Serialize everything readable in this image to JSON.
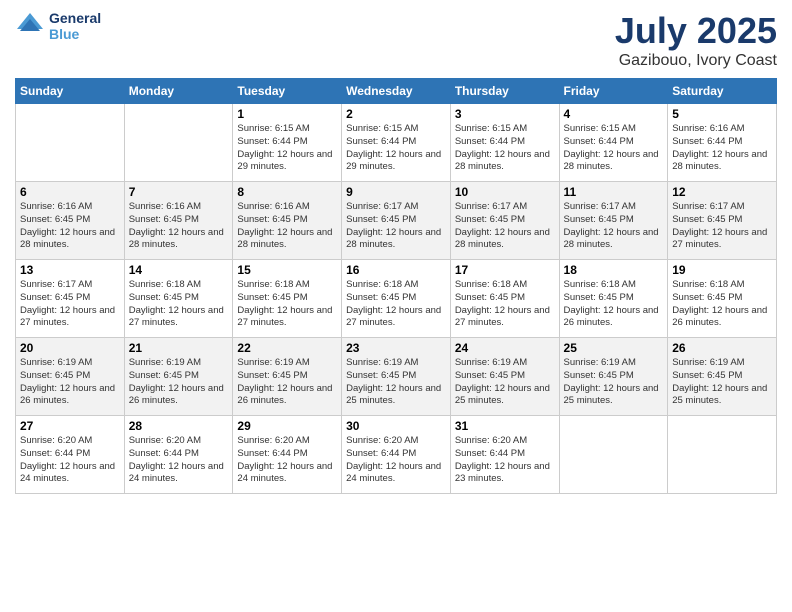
{
  "app": {
    "logo_line1": "General",
    "logo_line2": "Blue"
  },
  "header": {
    "title": "July 2025",
    "location": "Gazibouo, Ivory Coast"
  },
  "weekdays": [
    "Sunday",
    "Monday",
    "Tuesday",
    "Wednesday",
    "Thursday",
    "Friday",
    "Saturday"
  ],
  "weeks": [
    [
      {
        "day": "",
        "sunrise": "",
        "sunset": "",
        "daylight": ""
      },
      {
        "day": "",
        "sunrise": "",
        "sunset": "",
        "daylight": ""
      },
      {
        "day": "1",
        "sunrise": "Sunrise: 6:15 AM",
        "sunset": "Sunset: 6:44 PM",
        "daylight": "Daylight: 12 hours and 29 minutes."
      },
      {
        "day": "2",
        "sunrise": "Sunrise: 6:15 AM",
        "sunset": "Sunset: 6:44 PM",
        "daylight": "Daylight: 12 hours and 29 minutes."
      },
      {
        "day": "3",
        "sunrise": "Sunrise: 6:15 AM",
        "sunset": "Sunset: 6:44 PM",
        "daylight": "Daylight: 12 hours and 28 minutes."
      },
      {
        "day": "4",
        "sunrise": "Sunrise: 6:15 AM",
        "sunset": "Sunset: 6:44 PM",
        "daylight": "Daylight: 12 hours and 28 minutes."
      },
      {
        "day": "5",
        "sunrise": "Sunrise: 6:16 AM",
        "sunset": "Sunset: 6:44 PM",
        "daylight": "Daylight: 12 hours and 28 minutes."
      }
    ],
    [
      {
        "day": "6",
        "sunrise": "Sunrise: 6:16 AM",
        "sunset": "Sunset: 6:45 PM",
        "daylight": "Daylight: 12 hours and 28 minutes."
      },
      {
        "day": "7",
        "sunrise": "Sunrise: 6:16 AM",
        "sunset": "Sunset: 6:45 PM",
        "daylight": "Daylight: 12 hours and 28 minutes."
      },
      {
        "day": "8",
        "sunrise": "Sunrise: 6:16 AM",
        "sunset": "Sunset: 6:45 PM",
        "daylight": "Daylight: 12 hours and 28 minutes."
      },
      {
        "day": "9",
        "sunrise": "Sunrise: 6:17 AM",
        "sunset": "Sunset: 6:45 PM",
        "daylight": "Daylight: 12 hours and 28 minutes."
      },
      {
        "day": "10",
        "sunrise": "Sunrise: 6:17 AM",
        "sunset": "Sunset: 6:45 PM",
        "daylight": "Daylight: 12 hours and 28 minutes."
      },
      {
        "day": "11",
        "sunrise": "Sunrise: 6:17 AM",
        "sunset": "Sunset: 6:45 PM",
        "daylight": "Daylight: 12 hours and 28 minutes."
      },
      {
        "day": "12",
        "sunrise": "Sunrise: 6:17 AM",
        "sunset": "Sunset: 6:45 PM",
        "daylight": "Daylight: 12 hours and 27 minutes."
      }
    ],
    [
      {
        "day": "13",
        "sunrise": "Sunrise: 6:17 AM",
        "sunset": "Sunset: 6:45 PM",
        "daylight": "Daylight: 12 hours and 27 minutes."
      },
      {
        "day": "14",
        "sunrise": "Sunrise: 6:18 AM",
        "sunset": "Sunset: 6:45 PM",
        "daylight": "Daylight: 12 hours and 27 minutes."
      },
      {
        "day": "15",
        "sunrise": "Sunrise: 6:18 AM",
        "sunset": "Sunset: 6:45 PM",
        "daylight": "Daylight: 12 hours and 27 minutes."
      },
      {
        "day": "16",
        "sunrise": "Sunrise: 6:18 AM",
        "sunset": "Sunset: 6:45 PM",
        "daylight": "Daylight: 12 hours and 27 minutes."
      },
      {
        "day": "17",
        "sunrise": "Sunrise: 6:18 AM",
        "sunset": "Sunset: 6:45 PM",
        "daylight": "Daylight: 12 hours and 27 minutes."
      },
      {
        "day": "18",
        "sunrise": "Sunrise: 6:18 AM",
        "sunset": "Sunset: 6:45 PM",
        "daylight": "Daylight: 12 hours and 26 minutes."
      },
      {
        "day": "19",
        "sunrise": "Sunrise: 6:18 AM",
        "sunset": "Sunset: 6:45 PM",
        "daylight": "Daylight: 12 hours and 26 minutes."
      }
    ],
    [
      {
        "day": "20",
        "sunrise": "Sunrise: 6:19 AM",
        "sunset": "Sunset: 6:45 PM",
        "daylight": "Daylight: 12 hours and 26 minutes."
      },
      {
        "day": "21",
        "sunrise": "Sunrise: 6:19 AM",
        "sunset": "Sunset: 6:45 PM",
        "daylight": "Daylight: 12 hours and 26 minutes."
      },
      {
        "day": "22",
        "sunrise": "Sunrise: 6:19 AM",
        "sunset": "Sunset: 6:45 PM",
        "daylight": "Daylight: 12 hours and 26 minutes."
      },
      {
        "day": "23",
        "sunrise": "Sunrise: 6:19 AM",
        "sunset": "Sunset: 6:45 PM",
        "daylight": "Daylight: 12 hours and 25 minutes."
      },
      {
        "day": "24",
        "sunrise": "Sunrise: 6:19 AM",
        "sunset": "Sunset: 6:45 PM",
        "daylight": "Daylight: 12 hours and 25 minutes."
      },
      {
        "day": "25",
        "sunrise": "Sunrise: 6:19 AM",
        "sunset": "Sunset: 6:45 PM",
        "daylight": "Daylight: 12 hours and 25 minutes."
      },
      {
        "day": "26",
        "sunrise": "Sunrise: 6:19 AM",
        "sunset": "Sunset: 6:45 PM",
        "daylight": "Daylight: 12 hours and 25 minutes."
      }
    ],
    [
      {
        "day": "27",
        "sunrise": "Sunrise: 6:20 AM",
        "sunset": "Sunset: 6:44 PM",
        "daylight": "Daylight: 12 hours and 24 minutes."
      },
      {
        "day": "28",
        "sunrise": "Sunrise: 6:20 AM",
        "sunset": "Sunset: 6:44 PM",
        "daylight": "Daylight: 12 hours and 24 minutes."
      },
      {
        "day": "29",
        "sunrise": "Sunrise: 6:20 AM",
        "sunset": "Sunset: 6:44 PM",
        "daylight": "Daylight: 12 hours and 24 minutes."
      },
      {
        "day": "30",
        "sunrise": "Sunrise: 6:20 AM",
        "sunset": "Sunset: 6:44 PM",
        "daylight": "Daylight: 12 hours and 24 minutes."
      },
      {
        "day": "31",
        "sunrise": "Sunrise: 6:20 AM",
        "sunset": "Sunset: 6:44 PM",
        "daylight": "Daylight: 12 hours and 23 minutes."
      },
      {
        "day": "",
        "sunrise": "",
        "sunset": "",
        "daylight": ""
      },
      {
        "day": "",
        "sunrise": "",
        "sunset": "",
        "daylight": ""
      }
    ]
  ]
}
